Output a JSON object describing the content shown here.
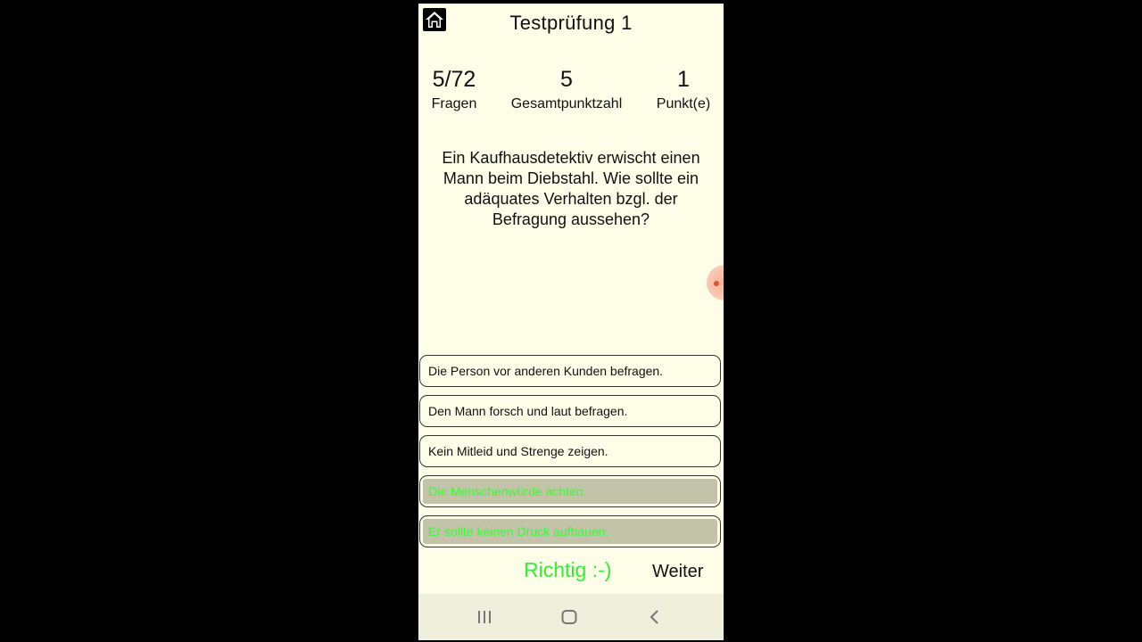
{
  "app": {
    "title": "Testprüfung 1"
  },
  "stats": [
    {
      "value": "5/72",
      "label": "Fragen"
    },
    {
      "value": "5",
      "label": "Gesamtpunktzahl"
    },
    {
      "value": "1",
      "label": "Punkt(e)"
    }
  ],
  "question": "Ein Kaufhausdetektiv erwischt einen Mann beim Diebstahl. Wie sollte ein adäquates Verhalten bzgl. der Befragung aussehen?",
  "answers": [
    {
      "text": "Die Person vor anderen Kunden befragen.",
      "correct": false
    },
    {
      "text": "Den Mann forsch und laut befragen.",
      "correct": false
    },
    {
      "text": "Kein Mitleid und Strenge zeigen.",
      "correct": false
    },
    {
      "text": "Die Menschenwürde achten.",
      "correct": true
    },
    {
      "text": "Er sollte keinen Druck aufbauen.",
      "correct": true
    }
  ],
  "feedback": {
    "result": "Richtig :-)",
    "next_label": "Weiter"
  },
  "colors": {
    "background": "#fefde8",
    "correct_text": "#33ff33",
    "correct_fill": "#c3c3a9",
    "result": "#33ee33"
  },
  "icons": {
    "home": "home-icon",
    "nav_recents": "recents-icon",
    "nav_home": "nav-home-icon",
    "nav_back": "back-icon"
  }
}
